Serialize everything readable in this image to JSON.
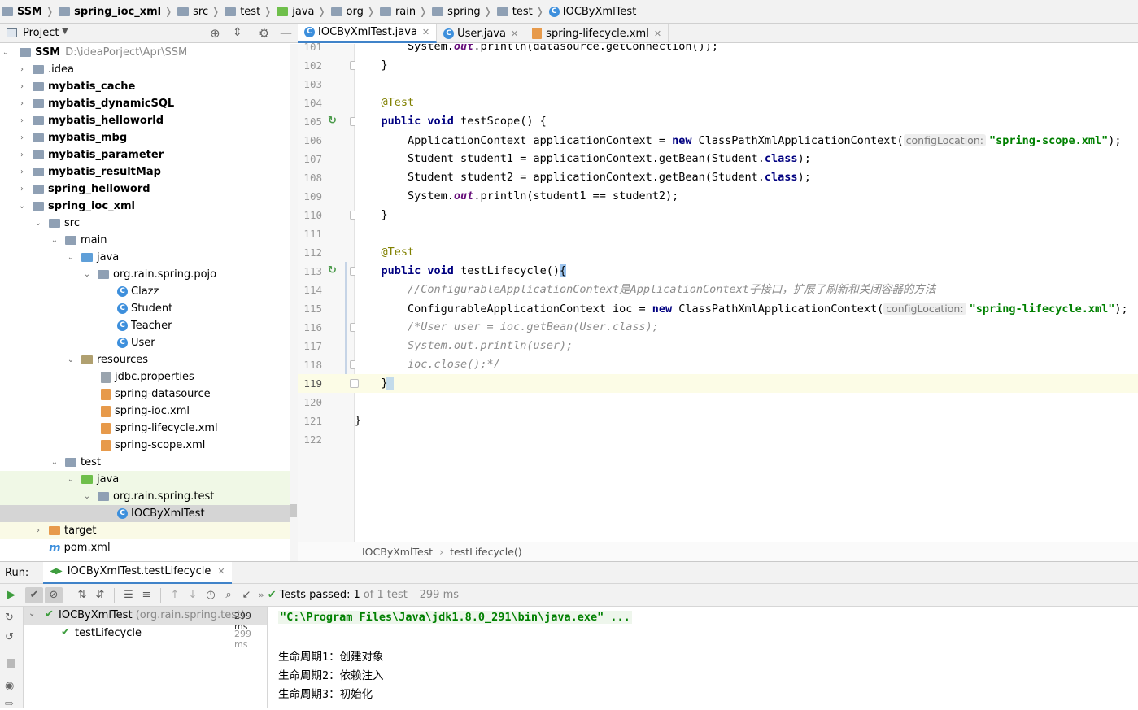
{
  "breadcrumb": [
    "SSM",
    "spring_ioc_xml",
    "src",
    "test",
    "java",
    "org",
    "rain",
    "spring",
    "test",
    "IOCByXmlTest"
  ],
  "project_panel": {
    "title": "Project"
  },
  "tree": [
    {
      "label": "SSM",
      "extra": "D:\\ideaPorject\\Apr\\SSM"
    },
    {
      "label": ".idea"
    },
    {
      "label": "mybatis_cache"
    },
    {
      "label": "mybatis_dynamicSQL"
    },
    {
      "label": "mybatis_helloworld"
    },
    {
      "label": "mybatis_mbg"
    },
    {
      "label": "mybatis_parameter"
    },
    {
      "label": "mybatis_resultMap"
    },
    {
      "label": "spring_helloword"
    },
    {
      "label": "spring_ioc_xml"
    },
    {
      "label": "src"
    },
    {
      "label": "main"
    },
    {
      "label": "java"
    },
    {
      "label": "org.rain.spring.pojo"
    },
    {
      "label": "Clazz"
    },
    {
      "label": "Student"
    },
    {
      "label": "Teacher"
    },
    {
      "label": "User"
    },
    {
      "label": "resources"
    },
    {
      "label": "jdbc.properties"
    },
    {
      "label": "spring-datasource"
    },
    {
      "label": "spring-ioc.xml"
    },
    {
      "label": "spring-lifecycle.xml"
    },
    {
      "label": "spring-scope.xml"
    },
    {
      "label": "test"
    },
    {
      "label": "java"
    },
    {
      "label": "org.rain.spring.test"
    },
    {
      "label": "IOCByXmlTest"
    },
    {
      "label": "target"
    },
    {
      "label": "pom.xml"
    }
  ],
  "tabs": [
    {
      "label": "IOCByXmlTest.java",
      "icon": "class-icon"
    },
    {
      "label": "User.java",
      "icon": "class-icon"
    },
    {
      "label": "spring-lifecycle.xml",
      "icon": "xml-icon"
    }
  ],
  "line_numbers": [
    "101",
    "102",
    "103",
    "104",
    "105",
    "106",
    "107",
    "108",
    "109",
    "110",
    "111",
    "112",
    "113",
    "114",
    "115",
    "116",
    "117",
    "118",
    "119",
    "120",
    "121",
    "122"
  ],
  "code": {
    "l101_a": "        System.",
    "l101_b": "out",
    "l101_c": ".println(datasource.getConnection());",
    "l102": "    }",
    "l104": "    @Test",
    "l105_a": "    public",
    "l105_b": " ",
    "l105_c": "void",
    "l105_d": " testScope() {",
    "l106_a": "        ApplicationContext applicationContext = ",
    "l106_b": "new",
    "l106_c": " ClassPathXmlApplicationContext(",
    "l106_hint": "configLocation:",
    "l106_d": "\"spring-scope.xml\"",
    "l106_e": ");",
    "l107_a": "        Student student1 = applicationContext.getBean(Student.",
    "l107_b": "class",
    "l107_c": ");",
    "l108_a": "        Student student2 = applicationContext.getBean(Student.",
    "l108_b": "class",
    "l108_c": ");",
    "l109_a": "        System.",
    "l109_b": "out",
    "l109_c": ".println(student1 == student2);",
    "l110": "    }",
    "l112": "    @Test",
    "l113_a": "    public",
    "l113_c": "void",
    "l113_d": " testLifecycle()",
    "l113_e": "{",
    "l114": "        //ConfigurableApplicationContext是ApplicationContext子接口，扩展了刷新和关闭容器的方法",
    "l115_a": "        ConfigurableApplicationContext ioc = ",
    "l115_b": "new",
    "l115_c": " ClassPathXmlApplicationContext(",
    "l115_hint": "configLocation:",
    "l115_d": "\"spring-lifecycle.xml\"",
    "l115_e": ");",
    "l116": "        /*User user = ioc.getBean(User.class);",
    "l117": "        System.out.println(user);",
    "l118": "        ioc.close();*/",
    "l119": "    }",
    "l121": "}"
  },
  "editor_breadcrumb": [
    "IOCByXmlTest",
    "testLifecycle()"
  ],
  "run": {
    "label": "Run:",
    "config": "IOCByXmlTest.testLifecycle",
    "status_pass": "Tests passed:",
    "status_count": "1",
    "status_rest": "of 1 test – 299 ms",
    "tree": [
      {
        "name": "IOCByXmlTest",
        "pkg": "(org.rain.spring.test)",
        "time": "299 ms"
      },
      {
        "name": "testLifecycle",
        "time": "299 ms"
      }
    ],
    "console": [
      "\"C:\\Program Files\\Java\\jdk1.8.0_291\\bin\\java.exe\" ...",
      "生命周期1：创建对象",
      "生命周期2：依赖注入",
      "生命周期3：初始化"
    ]
  },
  "colors": {
    "accent": "#4083c9",
    "keyword": "#000080",
    "string": "#008000",
    "comment": "#8c8c8c",
    "annotation": "#808000",
    "pass_green": "#3e9d3e"
  }
}
